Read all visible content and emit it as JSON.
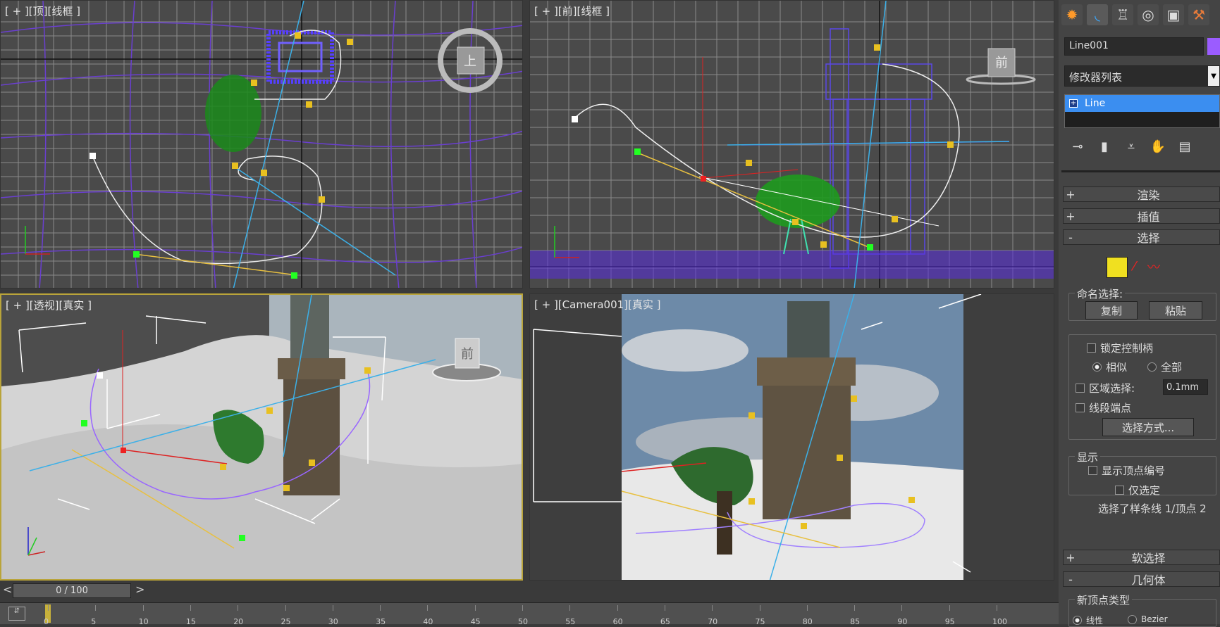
{
  "viewports": {
    "top": {
      "label": "[ + ][顶][线框 ]",
      "cube_label": "上"
    },
    "front": {
      "label": "[ + ][前][线框 ]",
      "cube_label": "前"
    },
    "perspective": {
      "label": "[ + ][透视][真实 ]",
      "cube_label": "前"
    },
    "camera": {
      "label": "[ + ][Camera001][真实 ]"
    }
  },
  "command_panel": {
    "tabs": [
      {
        "name": "create-tab",
        "glyph": "✹"
      },
      {
        "name": "modify-tab",
        "glyph": "◟"
      },
      {
        "name": "hierarchy-tab",
        "glyph": "♖"
      },
      {
        "name": "motion-tab",
        "glyph": "◎"
      },
      {
        "name": "display-tab",
        "glyph": "▣"
      },
      {
        "name": "utilities-tab",
        "glyph": "⚒"
      }
    ],
    "object_name": "Line001",
    "object_color": "#9b5cff",
    "modifier_list": "修改器列表",
    "stack_item": "Line",
    "rollouts": {
      "render": "渲染",
      "interpolation": "插值",
      "selection": "选择",
      "soft_selection": "软选择",
      "geometry": "几何体"
    },
    "selection": {
      "named_selection": "命名选择:",
      "copy": "复制",
      "paste": "粘贴",
      "lock_handles": "锁定控制柄",
      "alike": "相似",
      "all": "全部",
      "area_selection": "区域选择:",
      "area_value": "0.1mm",
      "segment_end": "线段端点",
      "select_by": "选择方式...",
      "display": "显示",
      "show_vertex_numbers": "显示顶点编号",
      "selected_only": "仅选定",
      "status": "选择了样条线 1/顶点 2"
    },
    "geometry": {
      "new_vertex_type": "新顶点类型",
      "linear": "线性",
      "bezier": "Bezier"
    }
  },
  "timeline": {
    "frame": "0 / 100",
    "ticks": [
      "0",
      "5",
      "10",
      "15",
      "20",
      "25",
      "30",
      "35",
      "40",
      "45",
      "50",
      "55",
      "60",
      "65",
      "70",
      "75",
      "80",
      "85",
      "90",
      "95",
      "100"
    ]
  }
}
